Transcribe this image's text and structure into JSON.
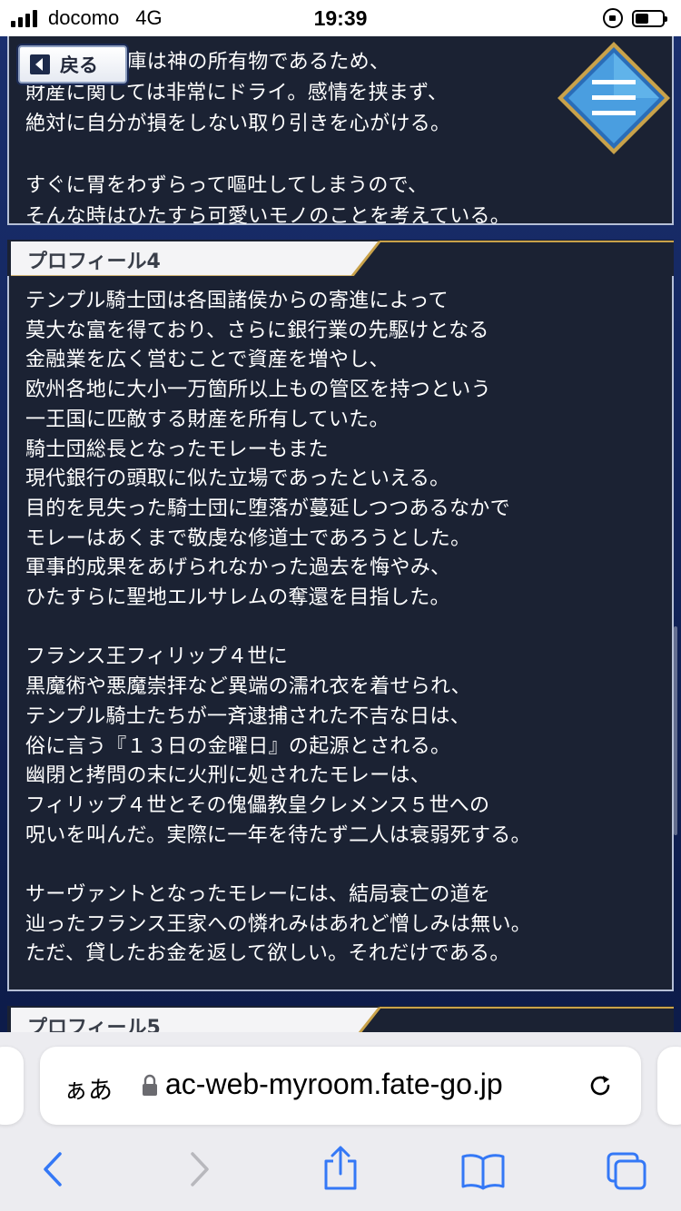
{
  "status_bar": {
    "carrier": "docomo",
    "network": "4G",
    "time": "19:39"
  },
  "page": {
    "back_label": "戻る",
    "top_panel_text": "騎士団の金庫は神の所有物であるため、\n財産に関しては非常にドライ。感情を挟まず、\n絶対に自分が損をしない取り引きを心がける。\n\nすぐに胃をわずらって嘔吐してしまうので、\nそんな時はひたすら可愛いモノのことを考えている。",
    "profile4": {
      "title": "プロフィール4",
      "text": "テンプル騎士団は各国諸侯からの寄進によって\n莫大な富を得ており、さらに銀行業の先駆けとなる\n金融業を広く営むことで資産を増やし、\n欧州各地に大小一万箇所以上もの管区を持つという\n一王国に匹敵する財産を所有していた。\n騎士団総長となったモレーもまた\n現代銀行の頭取に似た立場であったといえる。\n目的を見失った騎士団に堕落が蔓延しつつあるなかで\nモレーはあくまで敬虔な修道士であろうとした。\n軍事的成果をあげられなかった過去を悔やみ、\nひたすらに聖地エルサレムの奪還を目指した。\n\nフランス王フィリップ４世に\n黒魔術や悪魔崇拝など異端の濡れ衣を着せられ、\nテンプル騎士たちが一斉逮捕された不吉な日は、\n俗に言う『１３日の金曜日』の起源とされる。\n幽閉と拷問の末に火刑に処されたモレーは、\nフィリップ４世とその傀儡教皇クレメンス５世への\n呪いを叫んだ。実際に一年を待たず二人は衰弱死する。\n\nサーヴァントとなったモレーには、結局衰亡の道を\n辿ったフランス王家への憐れみはあれど憎しみは無い。\nただ、貸したお金を返して欲しい。それだけである。"
    },
    "profile5": {
      "title": "プロフィール5"
    }
  },
  "browser": {
    "text_size_label": "ぁあ",
    "url": "ac-web-myroom.fate-go.jp"
  },
  "colors": {
    "panel_bg": "#1b2233",
    "page_bg": "#12245a",
    "ios_blue": "#3478f6"
  }
}
